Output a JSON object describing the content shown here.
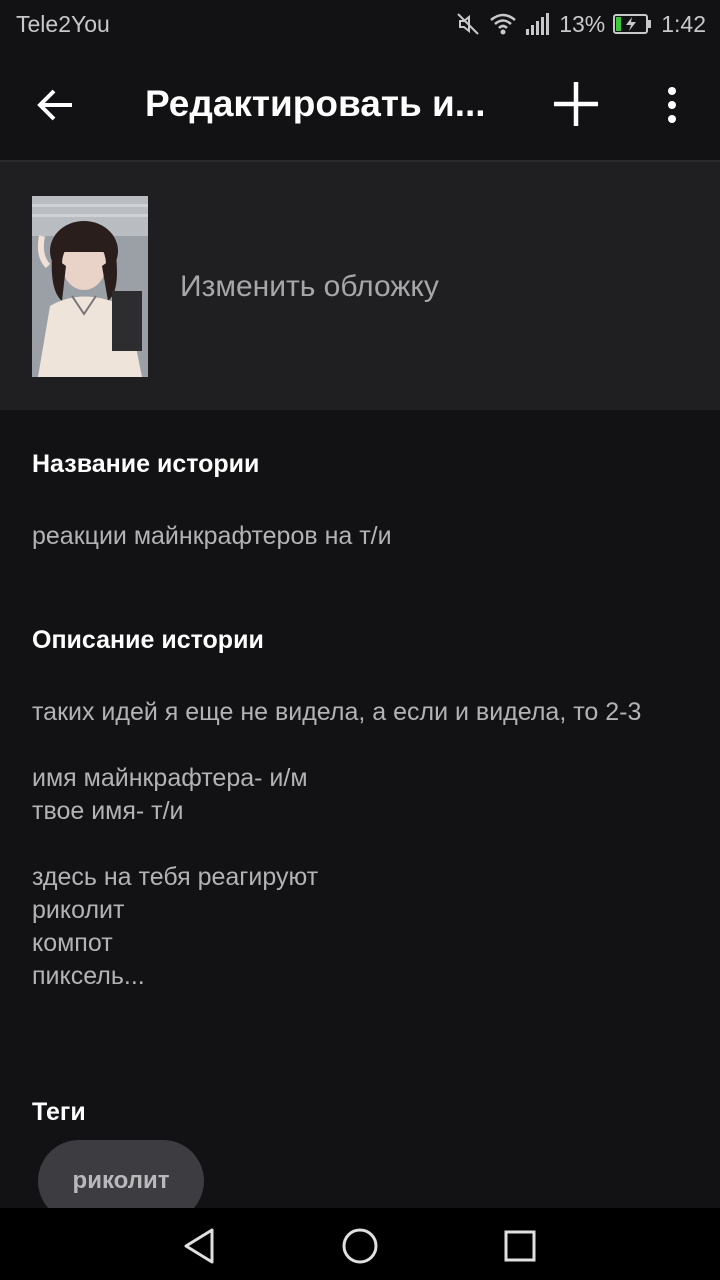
{
  "status_bar": {
    "carrier": "Tele2You",
    "battery": "13%",
    "time": "1:42",
    "icons": [
      "mute-icon",
      "wifi-icon",
      "signal-icon",
      "battery-charging-icon"
    ]
  },
  "app_bar": {
    "title": "Редактировать и...",
    "icons": [
      "back-arrow-icon",
      "plus-icon",
      "more-vert-icon"
    ]
  },
  "cover": {
    "change_label": "Изменить обложку"
  },
  "story": {
    "name_heading": "Название истории",
    "name_value": "реакции майнкрафтеров на т/и",
    "description_heading": "Описание истории",
    "description_value": "таких идей я еще не видела, а если и видела, то 2-3\n\nимя майнкрафтера- и/м\nтвое имя- т/и\n\nздесь на тебя реагируют\nриколит\nкомпот\nпиксель...",
    "tags_heading": "Теги",
    "tags": [
      "риколит"
    ]
  },
  "nav_bar": {
    "icons": [
      "nav-back-icon",
      "nav-home-icon",
      "nav-recents-icon"
    ]
  },
  "colors": {
    "background": "#121114",
    "cover_section": "#1f1e21",
    "tag_chip": "#3d3c40"
  }
}
